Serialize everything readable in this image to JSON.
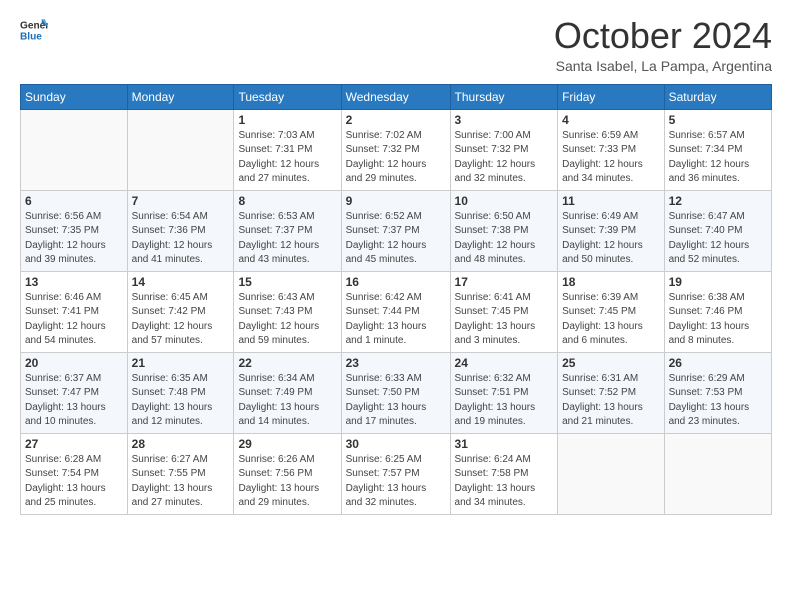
{
  "logo": {
    "line1": "General",
    "line2": "Blue"
  },
  "title": "October 2024",
  "subtitle": "Santa Isabel, La Pampa, Argentina",
  "days_header": [
    "Sunday",
    "Monday",
    "Tuesday",
    "Wednesday",
    "Thursday",
    "Friday",
    "Saturday"
  ],
  "weeks": [
    [
      {
        "day": "",
        "info": ""
      },
      {
        "day": "",
        "info": ""
      },
      {
        "day": "1",
        "info": "Sunrise: 7:03 AM\nSunset: 7:31 PM\nDaylight: 12 hours\nand 27 minutes."
      },
      {
        "day": "2",
        "info": "Sunrise: 7:02 AM\nSunset: 7:32 PM\nDaylight: 12 hours\nand 29 minutes."
      },
      {
        "day": "3",
        "info": "Sunrise: 7:00 AM\nSunset: 7:32 PM\nDaylight: 12 hours\nand 32 minutes."
      },
      {
        "day": "4",
        "info": "Sunrise: 6:59 AM\nSunset: 7:33 PM\nDaylight: 12 hours\nand 34 minutes."
      },
      {
        "day": "5",
        "info": "Sunrise: 6:57 AM\nSunset: 7:34 PM\nDaylight: 12 hours\nand 36 minutes."
      }
    ],
    [
      {
        "day": "6",
        "info": "Sunrise: 6:56 AM\nSunset: 7:35 PM\nDaylight: 12 hours\nand 39 minutes."
      },
      {
        "day": "7",
        "info": "Sunrise: 6:54 AM\nSunset: 7:36 PM\nDaylight: 12 hours\nand 41 minutes."
      },
      {
        "day": "8",
        "info": "Sunrise: 6:53 AM\nSunset: 7:37 PM\nDaylight: 12 hours\nand 43 minutes."
      },
      {
        "day": "9",
        "info": "Sunrise: 6:52 AM\nSunset: 7:37 PM\nDaylight: 12 hours\nand 45 minutes."
      },
      {
        "day": "10",
        "info": "Sunrise: 6:50 AM\nSunset: 7:38 PM\nDaylight: 12 hours\nand 48 minutes."
      },
      {
        "day": "11",
        "info": "Sunrise: 6:49 AM\nSunset: 7:39 PM\nDaylight: 12 hours\nand 50 minutes."
      },
      {
        "day": "12",
        "info": "Sunrise: 6:47 AM\nSunset: 7:40 PM\nDaylight: 12 hours\nand 52 minutes."
      }
    ],
    [
      {
        "day": "13",
        "info": "Sunrise: 6:46 AM\nSunset: 7:41 PM\nDaylight: 12 hours\nand 54 minutes."
      },
      {
        "day": "14",
        "info": "Sunrise: 6:45 AM\nSunset: 7:42 PM\nDaylight: 12 hours\nand 57 minutes."
      },
      {
        "day": "15",
        "info": "Sunrise: 6:43 AM\nSunset: 7:43 PM\nDaylight: 12 hours\nand 59 minutes."
      },
      {
        "day": "16",
        "info": "Sunrise: 6:42 AM\nSunset: 7:44 PM\nDaylight: 13 hours\nand 1 minute."
      },
      {
        "day": "17",
        "info": "Sunrise: 6:41 AM\nSunset: 7:45 PM\nDaylight: 13 hours\nand 3 minutes."
      },
      {
        "day": "18",
        "info": "Sunrise: 6:39 AM\nSunset: 7:45 PM\nDaylight: 13 hours\nand 6 minutes."
      },
      {
        "day": "19",
        "info": "Sunrise: 6:38 AM\nSunset: 7:46 PM\nDaylight: 13 hours\nand 8 minutes."
      }
    ],
    [
      {
        "day": "20",
        "info": "Sunrise: 6:37 AM\nSunset: 7:47 PM\nDaylight: 13 hours\nand 10 minutes."
      },
      {
        "day": "21",
        "info": "Sunrise: 6:35 AM\nSunset: 7:48 PM\nDaylight: 13 hours\nand 12 minutes."
      },
      {
        "day": "22",
        "info": "Sunrise: 6:34 AM\nSunset: 7:49 PM\nDaylight: 13 hours\nand 14 minutes."
      },
      {
        "day": "23",
        "info": "Sunrise: 6:33 AM\nSunset: 7:50 PM\nDaylight: 13 hours\nand 17 minutes."
      },
      {
        "day": "24",
        "info": "Sunrise: 6:32 AM\nSunset: 7:51 PM\nDaylight: 13 hours\nand 19 minutes."
      },
      {
        "day": "25",
        "info": "Sunrise: 6:31 AM\nSunset: 7:52 PM\nDaylight: 13 hours\nand 21 minutes."
      },
      {
        "day": "26",
        "info": "Sunrise: 6:29 AM\nSunset: 7:53 PM\nDaylight: 13 hours\nand 23 minutes."
      }
    ],
    [
      {
        "day": "27",
        "info": "Sunrise: 6:28 AM\nSunset: 7:54 PM\nDaylight: 13 hours\nand 25 minutes."
      },
      {
        "day": "28",
        "info": "Sunrise: 6:27 AM\nSunset: 7:55 PM\nDaylight: 13 hours\nand 27 minutes."
      },
      {
        "day": "29",
        "info": "Sunrise: 6:26 AM\nSunset: 7:56 PM\nDaylight: 13 hours\nand 29 minutes."
      },
      {
        "day": "30",
        "info": "Sunrise: 6:25 AM\nSunset: 7:57 PM\nDaylight: 13 hours\nand 32 minutes."
      },
      {
        "day": "31",
        "info": "Sunrise: 6:24 AM\nSunset: 7:58 PM\nDaylight: 13 hours\nand 34 minutes."
      },
      {
        "day": "",
        "info": ""
      },
      {
        "day": "",
        "info": ""
      }
    ]
  ]
}
